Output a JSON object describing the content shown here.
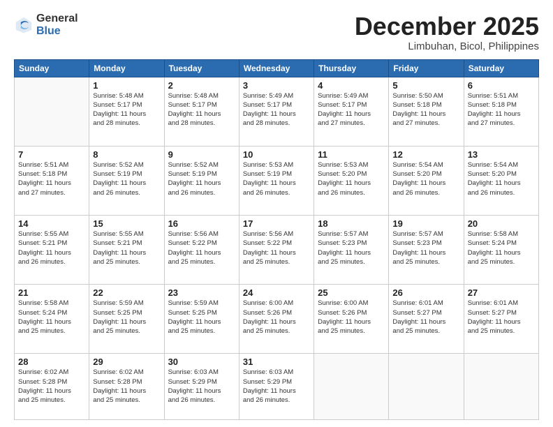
{
  "logo": {
    "general": "General",
    "blue": "Blue"
  },
  "title": "December 2025",
  "location": "Limbuhan, Bicol, Philippines",
  "headers": [
    "Sunday",
    "Monday",
    "Tuesday",
    "Wednesday",
    "Thursday",
    "Friday",
    "Saturday"
  ],
  "weeks": [
    [
      {
        "day": "",
        "info": ""
      },
      {
        "day": "1",
        "info": "Sunrise: 5:48 AM\nSunset: 5:17 PM\nDaylight: 11 hours\nand 28 minutes."
      },
      {
        "day": "2",
        "info": "Sunrise: 5:48 AM\nSunset: 5:17 PM\nDaylight: 11 hours\nand 28 minutes."
      },
      {
        "day": "3",
        "info": "Sunrise: 5:49 AM\nSunset: 5:17 PM\nDaylight: 11 hours\nand 28 minutes."
      },
      {
        "day": "4",
        "info": "Sunrise: 5:49 AM\nSunset: 5:17 PM\nDaylight: 11 hours\nand 27 minutes."
      },
      {
        "day": "5",
        "info": "Sunrise: 5:50 AM\nSunset: 5:18 PM\nDaylight: 11 hours\nand 27 minutes."
      },
      {
        "day": "6",
        "info": "Sunrise: 5:51 AM\nSunset: 5:18 PM\nDaylight: 11 hours\nand 27 minutes."
      }
    ],
    [
      {
        "day": "7",
        "info": "Sunrise: 5:51 AM\nSunset: 5:18 PM\nDaylight: 11 hours\nand 27 minutes."
      },
      {
        "day": "8",
        "info": "Sunrise: 5:52 AM\nSunset: 5:19 PM\nDaylight: 11 hours\nand 26 minutes."
      },
      {
        "day": "9",
        "info": "Sunrise: 5:52 AM\nSunset: 5:19 PM\nDaylight: 11 hours\nand 26 minutes."
      },
      {
        "day": "10",
        "info": "Sunrise: 5:53 AM\nSunset: 5:19 PM\nDaylight: 11 hours\nand 26 minutes."
      },
      {
        "day": "11",
        "info": "Sunrise: 5:53 AM\nSunset: 5:20 PM\nDaylight: 11 hours\nand 26 minutes."
      },
      {
        "day": "12",
        "info": "Sunrise: 5:54 AM\nSunset: 5:20 PM\nDaylight: 11 hours\nand 26 minutes."
      },
      {
        "day": "13",
        "info": "Sunrise: 5:54 AM\nSunset: 5:20 PM\nDaylight: 11 hours\nand 26 minutes."
      }
    ],
    [
      {
        "day": "14",
        "info": "Sunrise: 5:55 AM\nSunset: 5:21 PM\nDaylight: 11 hours\nand 26 minutes."
      },
      {
        "day": "15",
        "info": "Sunrise: 5:55 AM\nSunset: 5:21 PM\nDaylight: 11 hours\nand 25 minutes."
      },
      {
        "day": "16",
        "info": "Sunrise: 5:56 AM\nSunset: 5:22 PM\nDaylight: 11 hours\nand 25 minutes."
      },
      {
        "day": "17",
        "info": "Sunrise: 5:56 AM\nSunset: 5:22 PM\nDaylight: 11 hours\nand 25 minutes."
      },
      {
        "day": "18",
        "info": "Sunrise: 5:57 AM\nSunset: 5:23 PM\nDaylight: 11 hours\nand 25 minutes."
      },
      {
        "day": "19",
        "info": "Sunrise: 5:57 AM\nSunset: 5:23 PM\nDaylight: 11 hours\nand 25 minutes."
      },
      {
        "day": "20",
        "info": "Sunrise: 5:58 AM\nSunset: 5:24 PM\nDaylight: 11 hours\nand 25 minutes."
      }
    ],
    [
      {
        "day": "21",
        "info": "Sunrise: 5:58 AM\nSunset: 5:24 PM\nDaylight: 11 hours\nand 25 minutes."
      },
      {
        "day": "22",
        "info": "Sunrise: 5:59 AM\nSunset: 5:25 PM\nDaylight: 11 hours\nand 25 minutes."
      },
      {
        "day": "23",
        "info": "Sunrise: 5:59 AM\nSunset: 5:25 PM\nDaylight: 11 hours\nand 25 minutes."
      },
      {
        "day": "24",
        "info": "Sunrise: 6:00 AM\nSunset: 5:26 PM\nDaylight: 11 hours\nand 25 minutes."
      },
      {
        "day": "25",
        "info": "Sunrise: 6:00 AM\nSunset: 5:26 PM\nDaylight: 11 hours\nand 25 minutes."
      },
      {
        "day": "26",
        "info": "Sunrise: 6:01 AM\nSunset: 5:27 PM\nDaylight: 11 hours\nand 25 minutes."
      },
      {
        "day": "27",
        "info": "Sunrise: 6:01 AM\nSunset: 5:27 PM\nDaylight: 11 hours\nand 25 minutes."
      }
    ],
    [
      {
        "day": "28",
        "info": "Sunrise: 6:02 AM\nSunset: 5:28 PM\nDaylight: 11 hours\nand 25 minutes."
      },
      {
        "day": "29",
        "info": "Sunrise: 6:02 AM\nSunset: 5:28 PM\nDaylight: 11 hours\nand 25 minutes."
      },
      {
        "day": "30",
        "info": "Sunrise: 6:03 AM\nSunset: 5:29 PM\nDaylight: 11 hours\nand 26 minutes."
      },
      {
        "day": "31",
        "info": "Sunrise: 6:03 AM\nSunset: 5:29 PM\nDaylight: 11 hours\nand 26 minutes."
      },
      {
        "day": "",
        "info": ""
      },
      {
        "day": "",
        "info": ""
      },
      {
        "day": "",
        "info": ""
      }
    ]
  ]
}
